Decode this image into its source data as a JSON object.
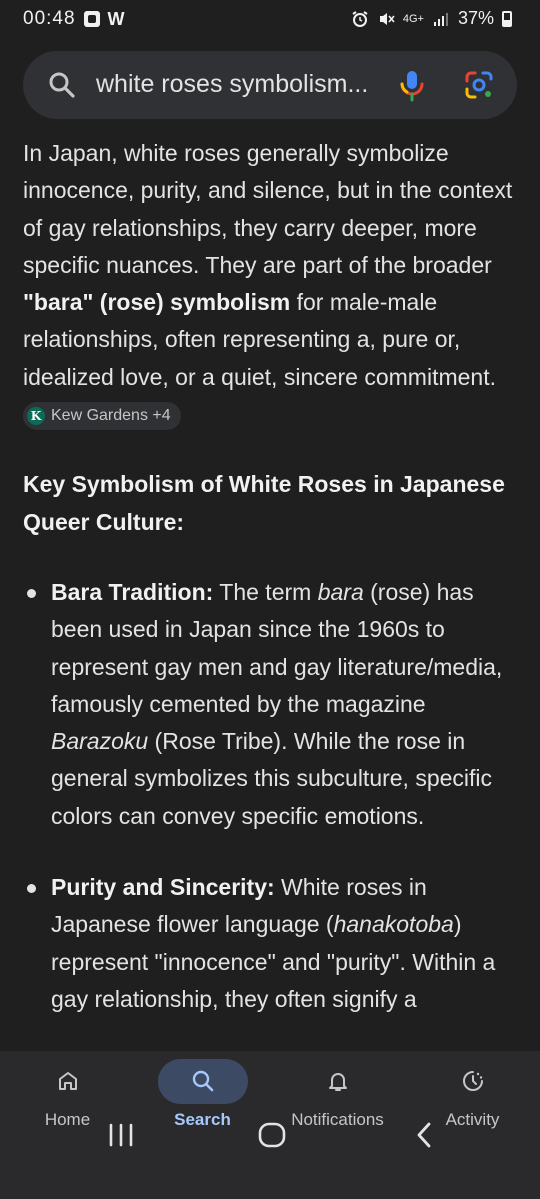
{
  "status_bar": {
    "time": "00:48",
    "carrier_icon": "W",
    "network": "4G+",
    "battery": "37%"
  },
  "search": {
    "query": "white roses symbolism..."
  },
  "answer": {
    "para1_a": "In Japan, white roses generally symbolize innocence, purity, and silence, but in the context of gay relationships, they carry deeper, more specific nuances. They are part of the broader ",
    "para1_b": "\"bara\" (rose) symbolism",
    "para1_c": " for male-male relationships, often representing a, pure or, idealized love, or a quiet, sincere commitment.",
    "source_chip": "Kew Gardens +4",
    "heading": "Key Symbolism of White Roses in Japanese Queer Culture:",
    "bullets": [
      {
        "title": "Bara Tradition:",
        "t1": " The term ",
        "i1": "bara",
        "t2": " (rose) has been used in Japan since the 1960s to represent gay men and gay literature/media, famously cemented by the magazine ",
        "i2": "Barazoku",
        "t3": " (Rose Tribe). While the rose in general symbolizes this subculture, specific colors can convey specific emotions."
      },
      {
        "title": "Purity and Sincerity:",
        "t1": " White roses in Japanese flower language (",
        "i1": "hanakotoba",
        "t2": ") represent \"innocence\" and \"purity\". Within a gay relationship, they often signify a"
      }
    ]
  },
  "bottom_nav": {
    "items": [
      {
        "label": "Home",
        "icon": "home-icon"
      },
      {
        "label": "Search",
        "icon": "search-icon",
        "active": true
      },
      {
        "label": "Notifications",
        "icon": "bell-icon"
      },
      {
        "label": "Activity",
        "icon": "activity-icon"
      }
    ]
  },
  "colors": {
    "background": "#1f1f1f",
    "search_bg": "#303134",
    "active_nav": "#3d4a64",
    "active_label": "#a8c7fa"
  }
}
